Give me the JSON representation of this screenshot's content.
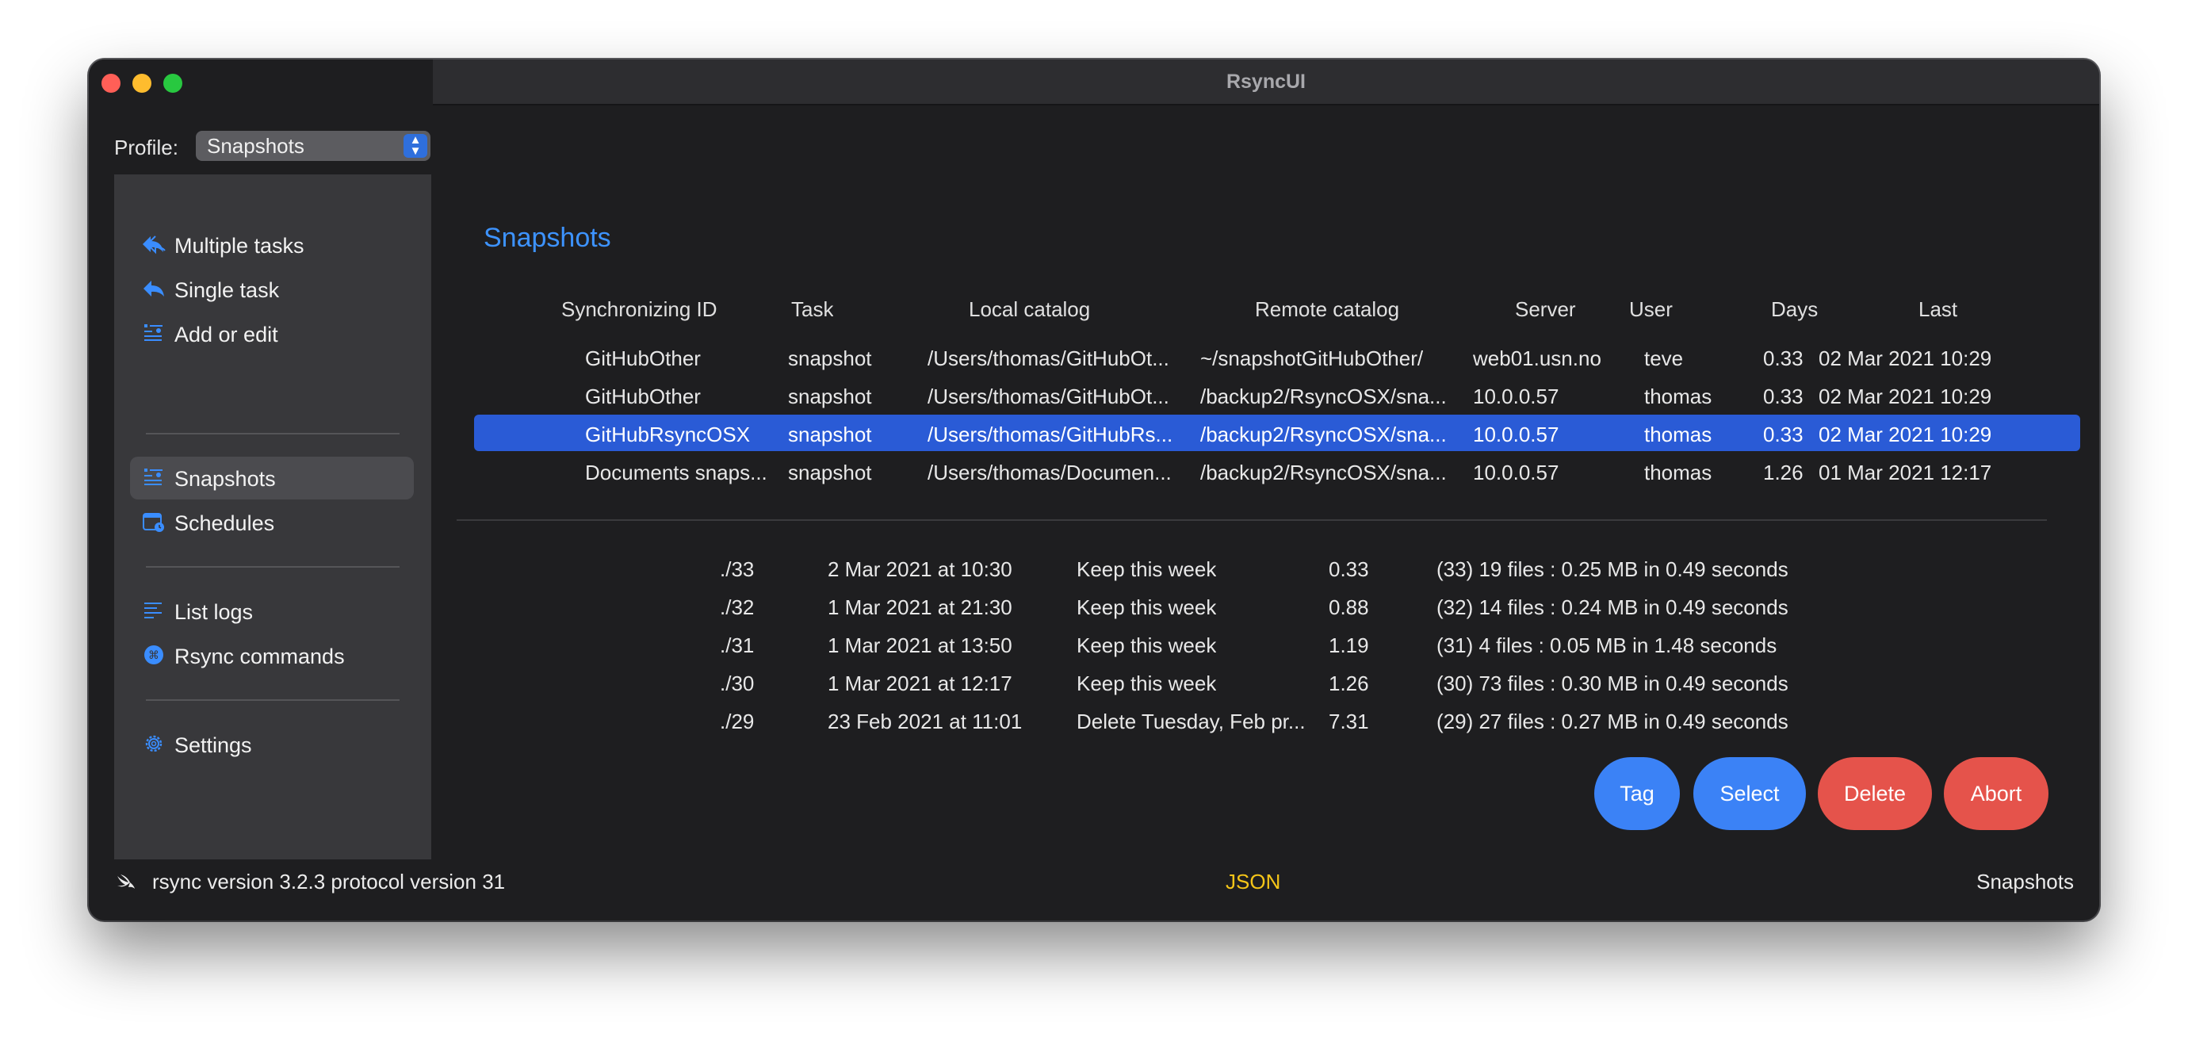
{
  "window": {
    "title": "RsyncUI"
  },
  "profile": {
    "label": "Profile:",
    "value": "Snapshots"
  },
  "sidebar": {
    "items": [
      {
        "label": "Multiple tasks",
        "icon": "double-arrow-back-icon"
      },
      {
        "label": "Single task",
        "icon": "arrow-back-icon"
      },
      {
        "label": "Add or edit",
        "icon": "list-person-icon"
      },
      {
        "label": "Snapshots",
        "icon": "list-person-icon",
        "active": true
      },
      {
        "label": "Schedules",
        "icon": "calendar-clock-icon"
      },
      {
        "label": "List logs",
        "icon": "text-lines-icon"
      },
      {
        "label": "Rsync commands",
        "icon": "command-circle-icon"
      },
      {
        "label": "Settings",
        "icon": "gear-icon"
      }
    ]
  },
  "main": {
    "title": "Snapshots",
    "columns": [
      "Synchronizing ID",
      "Task",
      "Local catalog",
      "Remote catalog",
      "Server",
      "User",
      "Days",
      "Last"
    ],
    "rows": [
      {
        "id": "GitHubOther",
        "task": "snapshot",
        "local": "/Users/thomas/GitHubOt...",
        "remote": "~/snapshotGitHubOther/",
        "server": "web01.usn.no",
        "user": "teve",
        "days": "0.33",
        "last": "02 Mar 2021 10:29"
      },
      {
        "id": "GitHubOther",
        "task": "snapshot",
        "local": "/Users/thomas/GitHubOt...",
        "remote": "/backup2/RsyncOSX/sna...",
        "server": "10.0.0.57",
        "user": "thomas",
        "days": "0.33",
        "last": "02 Mar 2021 10:29"
      },
      {
        "id": "GitHubRsyncOSX",
        "task": "snapshot",
        "local": "/Users/thomas/GitHubRs...",
        "remote": "/backup2/RsyncOSX/sna...",
        "server": "10.0.0.57",
        "user": "thomas",
        "days": "0.33",
        "last": "02 Mar 2021 10:29",
        "selected": true
      },
      {
        "id": "Documents snaps...",
        "task": "snapshot",
        "local": "/Users/thomas/Documen...",
        "remote": "/backup2/RsyncOSX/sna...",
        "server": "10.0.0.57",
        "user": "thomas",
        "days": "1.26",
        "last": "01 Mar 2021 12:17"
      }
    ],
    "snapshots": [
      {
        "catalog": "./33",
        "date": "2 Mar 2021 at 10:30",
        "plan": "Keep this week",
        "days": "0.33",
        "info": "(33) 19 files : 0.25 MB in 0.49 seconds"
      },
      {
        "catalog": "./32",
        "date": "1 Mar 2021 at 21:30",
        "plan": "Keep this week",
        "days": "0.88",
        "info": "(32) 14 files : 0.24 MB in 0.49 seconds"
      },
      {
        "catalog": "./31",
        "date": "1 Mar 2021 at 13:50",
        "plan": "Keep this week",
        "days": "1.19",
        "info": "(31) 4 files : 0.05 MB in 1.48 seconds"
      },
      {
        "catalog": "./30",
        "date": "1 Mar 2021 at 12:17",
        "plan": "Keep this week",
        "days": "1.26",
        "info": "(30) 73 files : 0.30 MB in 0.49 seconds"
      },
      {
        "catalog": "./29",
        "date": "23 Feb 2021 at 11:01",
        "plan": "Delete Tuesday, Feb pr...",
        "days": "7.31",
        "info": "(29) 27 files : 0.27 MB in 0.49 seconds"
      }
    ],
    "buttons": {
      "tag": "Tag",
      "select": "Select",
      "delete": "Delete",
      "abort": "Abort"
    }
  },
  "statusbar": {
    "rsync": "rsync  version 3.2.3  protocol version 31",
    "mode": "JSON",
    "profile": "Snapshots"
  },
  "colors": {
    "accent": "#3b82f6",
    "selection": "#2a5bd6",
    "danger": "#e5534b",
    "json": "#f5c518"
  }
}
